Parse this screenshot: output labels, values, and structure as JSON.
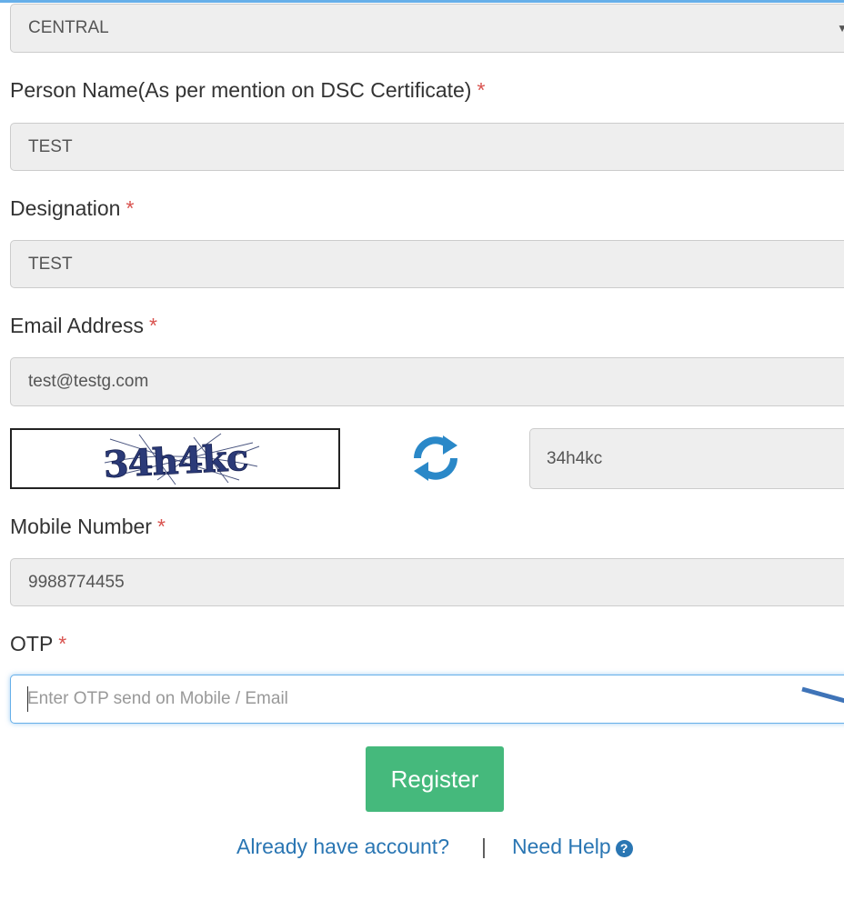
{
  "region": {
    "value": "CENTRAL"
  },
  "person_name": {
    "label": "Person Name(As per mention on DSC Certificate)",
    "required_mark": "*",
    "value": "TEST"
  },
  "designation": {
    "label": "Designation",
    "required_mark": "*",
    "value": "TEST"
  },
  "email": {
    "label": "Email Address",
    "required_mark": "*",
    "value": "test@testg.com"
  },
  "captcha": {
    "image_text": "34h4kc",
    "value": "34h4kc",
    "icon": "refresh-icon"
  },
  "mobile": {
    "label": "Mobile Number",
    "required_mark": "*",
    "value": "9988774455"
  },
  "otp": {
    "label": "OTP",
    "required_mark": "*",
    "placeholder": "Enter OTP send on Mobile / Email"
  },
  "register_button": {
    "label": "Register",
    "color": "#45b97c"
  },
  "footer": {
    "login_link": "Already have account?",
    "separator": "|",
    "help_link": "Need Help",
    "help_icon": "?"
  },
  "colors": {
    "required": "#d9534f",
    "link": "#2a76b3",
    "focus": "#66afe9",
    "input_bg": "#eeeeee"
  }
}
